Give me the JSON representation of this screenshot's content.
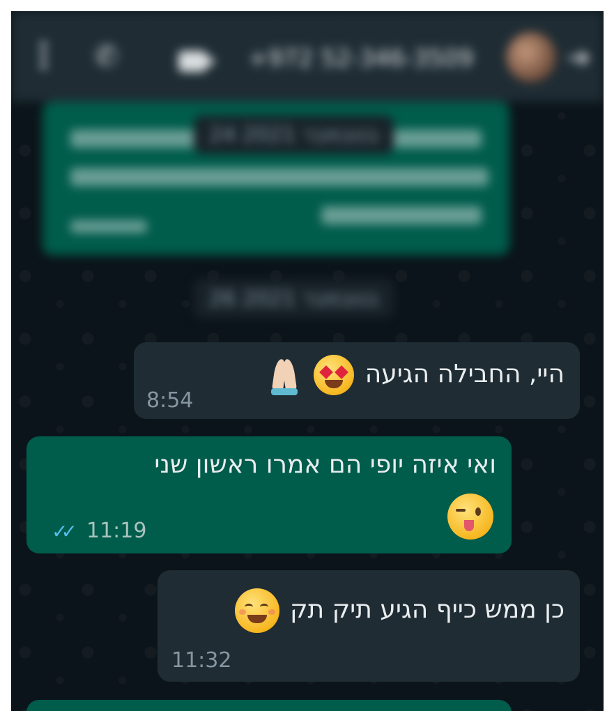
{
  "header": {
    "contact_name": "+972 52-346-3509",
    "icons": [
      "more-vertical-icon",
      "phone-icon",
      "video-call-icon",
      "back-arrow-icon"
    ]
  },
  "blurred": {
    "date_top": "24 בנובמבר 2021",
    "date_separator": "26 בנובמבר 2021"
  },
  "messages": [
    {
      "direction": "incoming",
      "text": "היי, החבילה הגיעה",
      "emojis": [
        "heart-eyes",
        "folded-hands"
      ],
      "time": "8:54"
    },
    {
      "direction": "outgoing",
      "line1": "ואי איזה יופי הם אמרו ראשון שני",
      "emojis": [
        "winking-tongue"
      ],
      "time": "11:19",
      "status": "read"
    },
    {
      "direction": "incoming",
      "text": "כן ממש כייף הגיע תיק תק",
      "emojis": [
        "smiling-face"
      ],
      "time": "11:32"
    }
  ],
  "colors": {
    "incoming_bubble": "#1f2c34",
    "outgoing_bubble": "#005c4b",
    "read_ticks": "#53bdeb",
    "background": "#0b141a"
  }
}
